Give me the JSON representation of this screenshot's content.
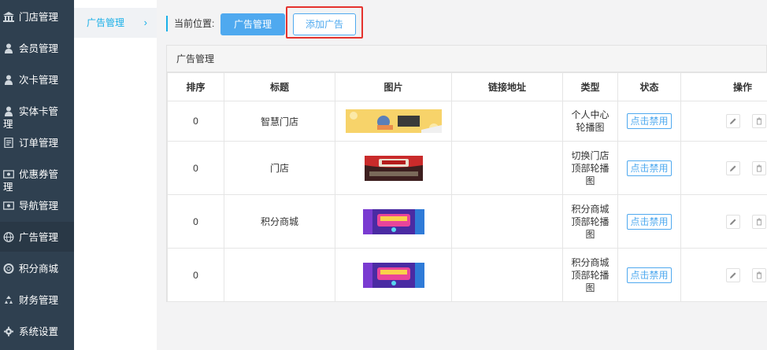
{
  "sidebar": {
    "items": [
      {
        "label": "门店管理",
        "icon": "bank-icon"
      },
      {
        "label": "会员管理",
        "icon": "user-icon"
      },
      {
        "label": "次卡管理",
        "icon": "user-icon"
      },
      {
        "label": "实体卡管",
        "label2": "理",
        "icon": "user-icon"
      },
      {
        "label": "订单管理",
        "icon": "document-icon"
      },
      {
        "label": "优惠券管",
        "label2": "理",
        "icon": "ticket-icon"
      },
      {
        "label": "导航管理",
        "icon": "ticket-icon"
      },
      {
        "label": "广告管理",
        "icon": "globe-icon"
      },
      {
        "label": "积分商城",
        "icon": "lifebuoy-icon"
      },
      {
        "label": "财务管理",
        "icon": "recycle-icon"
      },
      {
        "label": "系统设置",
        "icon": "gear-icon"
      }
    ]
  },
  "subnav": {
    "item": "广告管理",
    "chevron": "›"
  },
  "breadcrumb": {
    "label": "当前位置:"
  },
  "toolbar": {
    "current_label": "广告管理",
    "add_label": "添加广告"
  },
  "panel": {
    "title": "广告管理"
  },
  "table": {
    "headers": [
      "排序",
      "标题",
      "图片",
      "链接地址",
      "类型",
      "状态",
      "操作"
    ],
    "rows": [
      {
        "sort": "0",
        "title": "智慧门店",
        "link": "",
        "type_lines": [
          "个人中心",
          "轮播图"
        ],
        "status": "点击禁用",
        "image": "banner-yellow"
      },
      {
        "sort": "0",
        "title": "门店",
        "link": "",
        "type_lines": [
          "切换门店",
          "顶部轮播",
          "图"
        ],
        "status": "点击禁用",
        "image": "banner-red"
      },
      {
        "sort": "0",
        "title": "积分商城",
        "link": "",
        "type_lines": [
          "积分商城",
          "顶部轮播",
          "图"
        ],
        "status": "点击禁用",
        "image": "banner-purple"
      },
      {
        "sort": "0",
        "title": "",
        "link": "",
        "type_lines": [
          "积分商城",
          "顶部轮播",
          "图"
        ],
        "status": "点击禁用",
        "image": "banner-purple"
      }
    ]
  },
  "colors": {
    "sidebar_bg": "#2f4050",
    "accent": "#1ab0e8",
    "button": "#4fa9ef",
    "highlight": "#e5322d"
  }
}
